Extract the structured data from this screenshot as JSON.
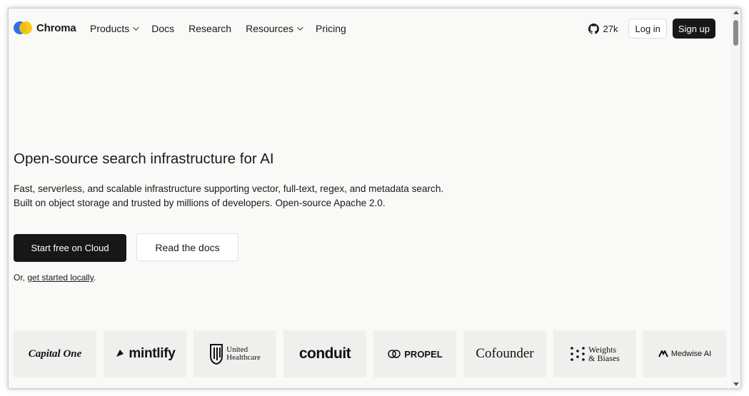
{
  "nav": {
    "brand": "Chroma",
    "menu": [
      {
        "label": "Products",
        "dropdown": true
      },
      {
        "label": "Docs",
        "dropdown": false
      },
      {
        "label": "Research",
        "dropdown": false
      },
      {
        "label": "Resources",
        "dropdown": true
      },
      {
        "label": "Pricing",
        "dropdown": false
      }
    ],
    "github_stars": "27k",
    "login_label": "Log in",
    "signup_label": "Sign up"
  },
  "hero": {
    "title": "Open-source search infrastructure for AI",
    "description": "Fast, serverless, and scalable infrastructure supporting vector, full-text, regex, and metadata search. Built on object storage and trusted by millions of developers. Open-source Apache 2.0.",
    "primary_cta": "Start free on Cloud",
    "secondary_cta": "Read the docs",
    "local_prefix": "Or, ",
    "local_link": "get started locally",
    "local_suffix": "."
  },
  "customers": [
    {
      "name": "CapitalOne",
      "text": "Capital One"
    },
    {
      "name": "mintlify",
      "text": "mintlify"
    },
    {
      "name": "united-healthcare",
      "line1": "United",
      "line2": "Healthcare"
    },
    {
      "name": "conduit",
      "text": "conduit"
    },
    {
      "name": "propel",
      "text": "PROPEL"
    },
    {
      "name": "cofounder",
      "text": "Cofounder"
    },
    {
      "name": "weights-biases",
      "line1": "Weights",
      "line2": "& Biases"
    },
    {
      "name": "medwise",
      "text": "Medwise AI"
    }
  ],
  "colors": {
    "background": "#f9f9f7",
    "primary_button": "#171717",
    "logo_blue": "#2f6fed",
    "logo_yellow": "#ffc300",
    "logo_card": "#efefed"
  }
}
